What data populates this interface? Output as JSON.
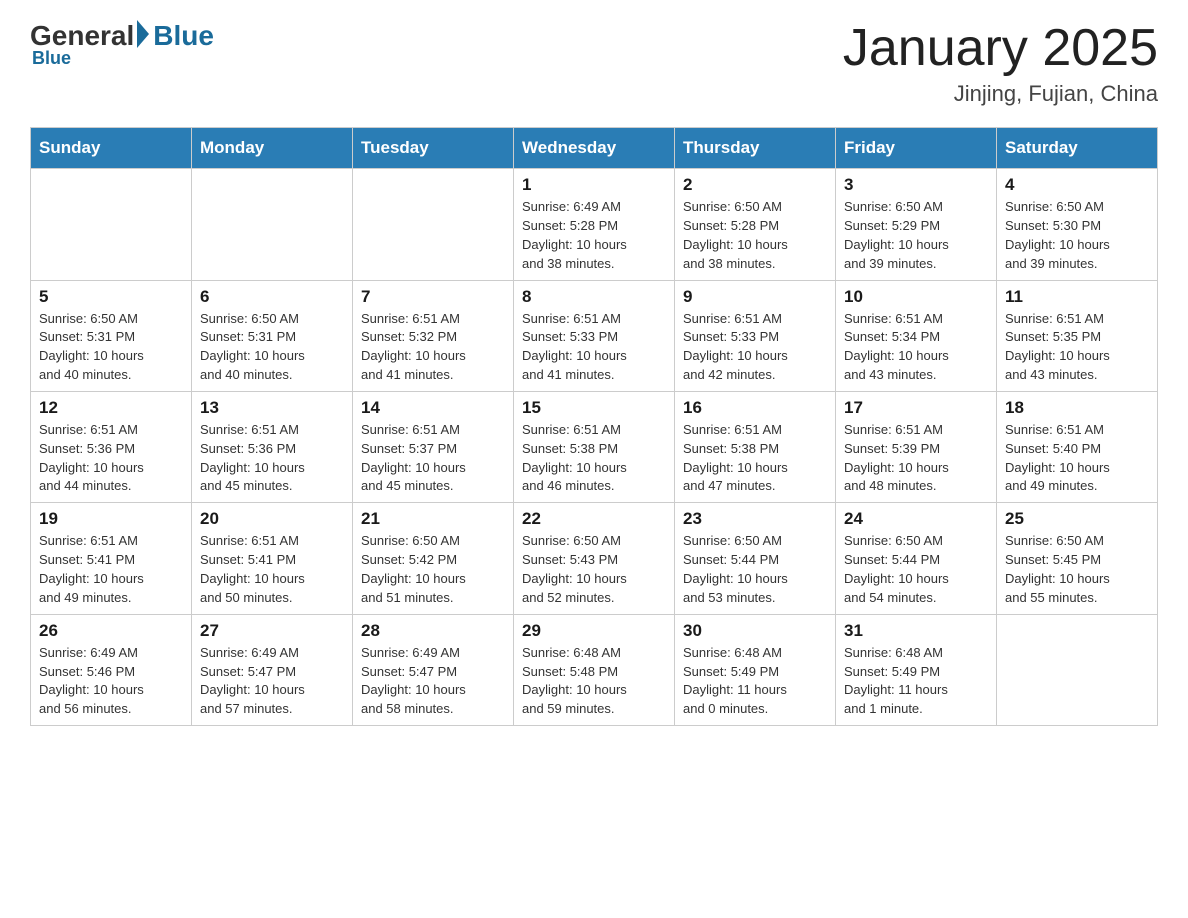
{
  "header": {
    "logo_general": "General",
    "logo_blue": "Blue",
    "month_title": "January 2025",
    "location": "Jinjing, Fujian, China"
  },
  "weekdays": [
    "Sunday",
    "Monday",
    "Tuesday",
    "Wednesday",
    "Thursday",
    "Friday",
    "Saturday"
  ],
  "weeks": [
    {
      "days": [
        {
          "num": "",
          "info": ""
        },
        {
          "num": "",
          "info": ""
        },
        {
          "num": "",
          "info": ""
        },
        {
          "num": "1",
          "info": "Sunrise: 6:49 AM\nSunset: 5:28 PM\nDaylight: 10 hours\nand 38 minutes."
        },
        {
          "num": "2",
          "info": "Sunrise: 6:50 AM\nSunset: 5:28 PM\nDaylight: 10 hours\nand 38 minutes."
        },
        {
          "num": "3",
          "info": "Sunrise: 6:50 AM\nSunset: 5:29 PM\nDaylight: 10 hours\nand 39 minutes."
        },
        {
          "num": "4",
          "info": "Sunrise: 6:50 AM\nSunset: 5:30 PM\nDaylight: 10 hours\nand 39 minutes."
        }
      ]
    },
    {
      "days": [
        {
          "num": "5",
          "info": "Sunrise: 6:50 AM\nSunset: 5:31 PM\nDaylight: 10 hours\nand 40 minutes."
        },
        {
          "num": "6",
          "info": "Sunrise: 6:50 AM\nSunset: 5:31 PM\nDaylight: 10 hours\nand 40 minutes."
        },
        {
          "num": "7",
          "info": "Sunrise: 6:51 AM\nSunset: 5:32 PM\nDaylight: 10 hours\nand 41 minutes."
        },
        {
          "num": "8",
          "info": "Sunrise: 6:51 AM\nSunset: 5:33 PM\nDaylight: 10 hours\nand 41 minutes."
        },
        {
          "num": "9",
          "info": "Sunrise: 6:51 AM\nSunset: 5:33 PM\nDaylight: 10 hours\nand 42 minutes."
        },
        {
          "num": "10",
          "info": "Sunrise: 6:51 AM\nSunset: 5:34 PM\nDaylight: 10 hours\nand 43 minutes."
        },
        {
          "num": "11",
          "info": "Sunrise: 6:51 AM\nSunset: 5:35 PM\nDaylight: 10 hours\nand 43 minutes."
        }
      ]
    },
    {
      "days": [
        {
          "num": "12",
          "info": "Sunrise: 6:51 AM\nSunset: 5:36 PM\nDaylight: 10 hours\nand 44 minutes."
        },
        {
          "num": "13",
          "info": "Sunrise: 6:51 AM\nSunset: 5:36 PM\nDaylight: 10 hours\nand 45 minutes."
        },
        {
          "num": "14",
          "info": "Sunrise: 6:51 AM\nSunset: 5:37 PM\nDaylight: 10 hours\nand 45 minutes."
        },
        {
          "num": "15",
          "info": "Sunrise: 6:51 AM\nSunset: 5:38 PM\nDaylight: 10 hours\nand 46 minutes."
        },
        {
          "num": "16",
          "info": "Sunrise: 6:51 AM\nSunset: 5:38 PM\nDaylight: 10 hours\nand 47 minutes."
        },
        {
          "num": "17",
          "info": "Sunrise: 6:51 AM\nSunset: 5:39 PM\nDaylight: 10 hours\nand 48 minutes."
        },
        {
          "num": "18",
          "info": "Sunrise: 6:51 AM\nSunset: 5:40 PM\nDaylight: 10 hours\nand 49 minutes."
        }
      ]
    },
    {
      "days": [
        {
          "num": "19",
          "info": "Sunrise: 6:51 AM\nSunset: 5:41 PM\nDaylight: 10 hours\nand 49 minutes."
        },
        {
          "num": "20",
          "info": "Sunrise: 6:51 AM\nSunset: 5:41 PM\nDaylight: 10 hours\nand 50 minutes."
        },
        {
          "num": "21",
          "info": "Sunrise: 6:50 AM\nSunset: 5:42 PM\nDaylight: 10 hours\nand 51 minutes."
        },
        {
          "num": "22",
          "info": "Sunrise: 6:50 AM\nSunset: 5:43 PM\nDaylight: 10 hours\nand 52 minutes."
        },
        {
          "num": "23",
          "info": "Sunrise: 6:50 AM\nSunset: 5:44 PM\nDaylight: 10 hours\nand 53 minutes."
        },
        {
          "num": "24",
          "info": "Sunrise: 6:50 AM\nSunset: 5:44 PM\nDaylight: 10 hours\nand 54 minutes."
        },
        {
          "num": "25",
          "info": "Sunrise: 6:50 AM\nSunset: 5:45 PM\nDaylight: 10 hours\nand 55 minutes."
        }
      ]
    },
    {
      "days": [
        {
          "num": "26",
          "info": "Sunrise: 6:49 AM\nSunset: 5:46 PM\nDaylight: 10 hours\nand 56 minutes."
        },
        {
          "num": "27",
          "info": "Sunrise: 6:49 AM\nSunset: 5:47 PM\nDaylight: 10 hours\nand 57 minutes."
        },
        {
          "num": "28",
          "info": "Sunrise: 6:49 AM\nSunset: 5:47 PM\nDaylight: 10 hours\nand 58 minutes."
        },
        {
          "num": "29",
          "info": "Sunrise: 6:48 AM\nSunset: 5:48 PM\nDaylight: 10 hours\nand 59 minutes."
        },
        {
          "num": "30",
          "info": "Sunrise: 6:48 AM\nSunset: 5:49 PM\nDaylight: 11 hours\nand 0 minutes."
        },
        {
          "num": "31",
          "info": "Sunrise: 6:48 AM\nSunset: 5:49 PM\nDaylight: 11 hours\nand 1 minute."
        },
        {
          "num": "",
          "info": ""
        }
      ]
    }
  ]
}
